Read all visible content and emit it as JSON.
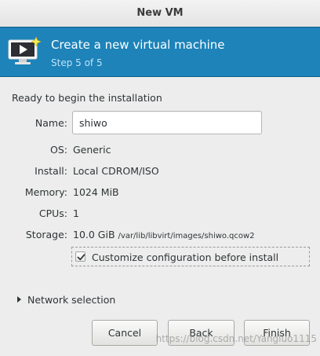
{
  "window": {
    "title": "New VM"
  },
  "banner": {
    "title": "Create a new virtual machine",
    "step": "Step 5 of 5",
    "icon": "monitor-play-icon"
  },
  "summary": {
    "heading": "Ready to begin the installation",
    "name_label": "Name:",
    "name_value": "shiwo",
    "os_label": "OS:",
    "os_value": "Generic",
    "install_label": "Install:",
    "install_value": "Local CDROM/ISO",
    "memory_label": "Memory:",
    "memory_value": "1024 MiB",
    "cpus_label": "CPUs:",
    "cpus_value": "1",
    "storage_label": "Storage:",
    "storage_size": "10.0 GiB",
    "storage_path": "/var/lib/libvirt/images/shiwo.qcow2"
  },
  "customize": {
    "label": "Customize configuration before install",
    "checked": true
  },
  "network": {
    "label": "Network selection",
    "expanded": false
  },
  "buttons": {
    "cancel": "Cancel",
    "back": "Back",
    "finish": "Finish"
  },
  "watermark": "https://blog.csdn.net/Yangluo1115"
}
